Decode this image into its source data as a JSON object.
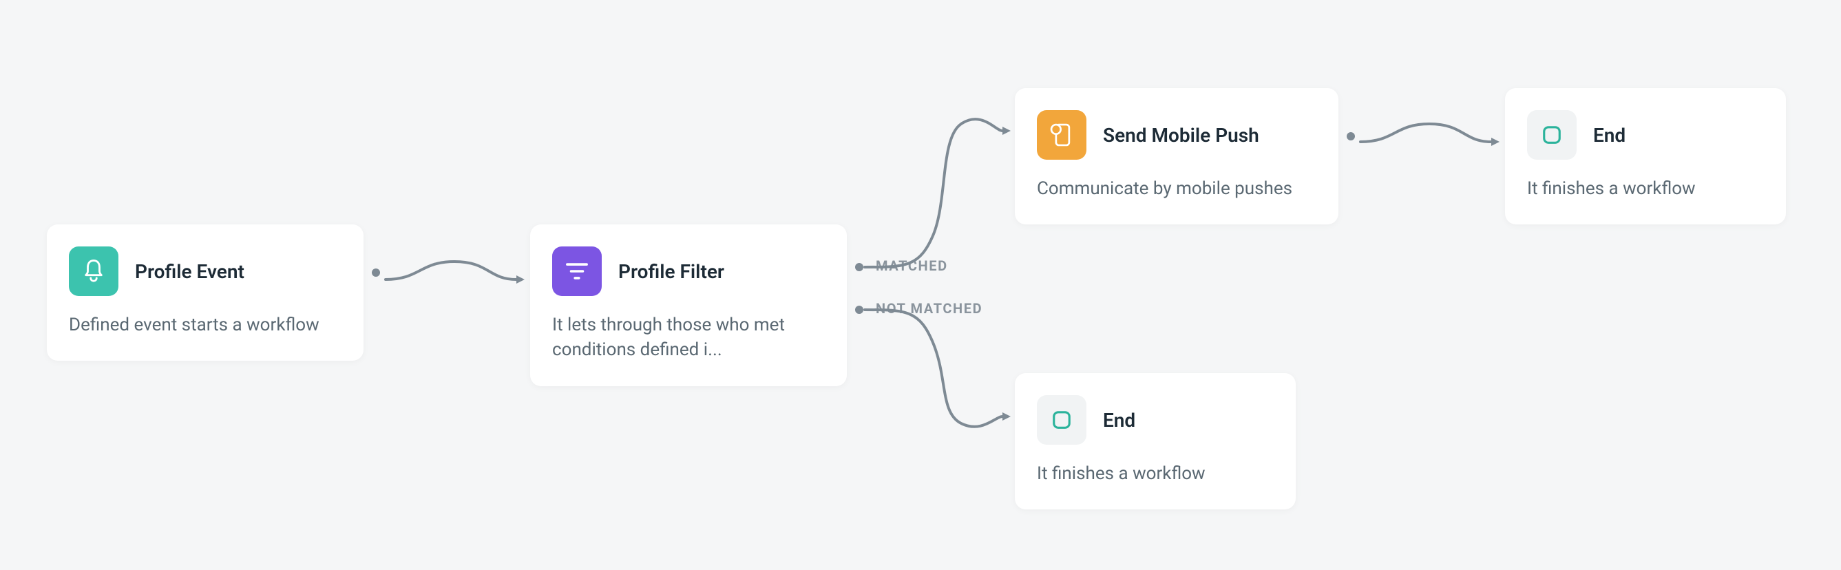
{
  "nodes": {
    "profile_event": {
      "title": "Profile Event",
      "subtitle": "Defined event starts a workflow"
    },
    "profile_filter": {
      "title": "Profile Filter",
      "subtitle": "It lets through those who met conditions defined i..."
    },
    "send_push": {
      "title": "Send Mobile Push",
      "subtitle": "Communicate by mobile pushes"
    },
    "end_top": {
      "title": "End",
      "subtitle": "It finishes a workflow"
    },
    "end_bottom": {
      "title": "End",
      "subtitle": "It finishes a workflow"
    }
  },
  "branch_labels": {
    "matched": "MATCHED",
    "not_matched": "NOT MATCHED"
  },
  "colors": {
    "teal": "#3cc3ae",
    "purple": "#7c55e3",
    "orange": "#f2a63b",
    "gray_icon_bg": "#f1f3f4",
    "connector": "#7e8a94",
    "card_bg": "#ffffff",
    "page_bg": "#f5f6f7",
    "text_primary": "#1d2b36",
    "text_secondary": "#5a6872"
  }
}
